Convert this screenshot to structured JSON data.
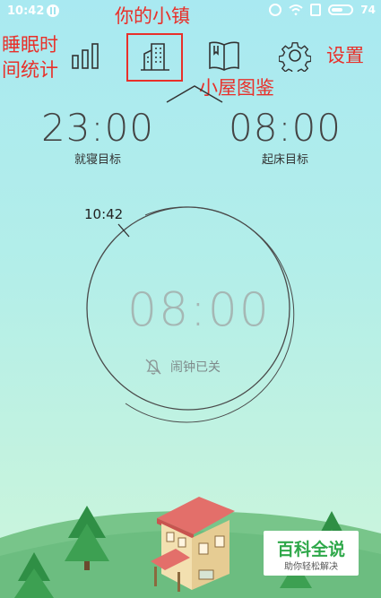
{
  "status_bar": {
    "time": "10:42",
    "battery": "74"
  },
  "annotations": {
    "top_center": "你的小镇",
    "left_line1": "睡眠时",
    "left_line2": "间统计",
    "right": "设置",
    "below_center": "小屋图鉴"
  },
  "nav": [
    {
      "name": "sleep-stats",
      "icon": "bar-chart-icon"
    },
    {
      "name": "town",
      "icon": "building-icon"
    },
    {
      "name": "house-gallery",
      "icon": "book-icon"
    },
    {
      "name": "settings",
      "icon": "gear-icon"
    }
  ],
  "targets": {
    "sleep": {
      "time": "23:00",
      "label": "就寝目标"
    },
    "wake": {
      "time": "08:00",
      "label": "起床目标"
    }
  },
  "clock": {
    "current_time": "10:42",
    "alarm_time": "08:00",
    "alarm_status": "闹钟已关",
    "alarm_icon": "bell-off-icon"
  },
  "watermark": {
    "title": "百科全说",
    "subtitle": "助你轻松解决"
  }
}
